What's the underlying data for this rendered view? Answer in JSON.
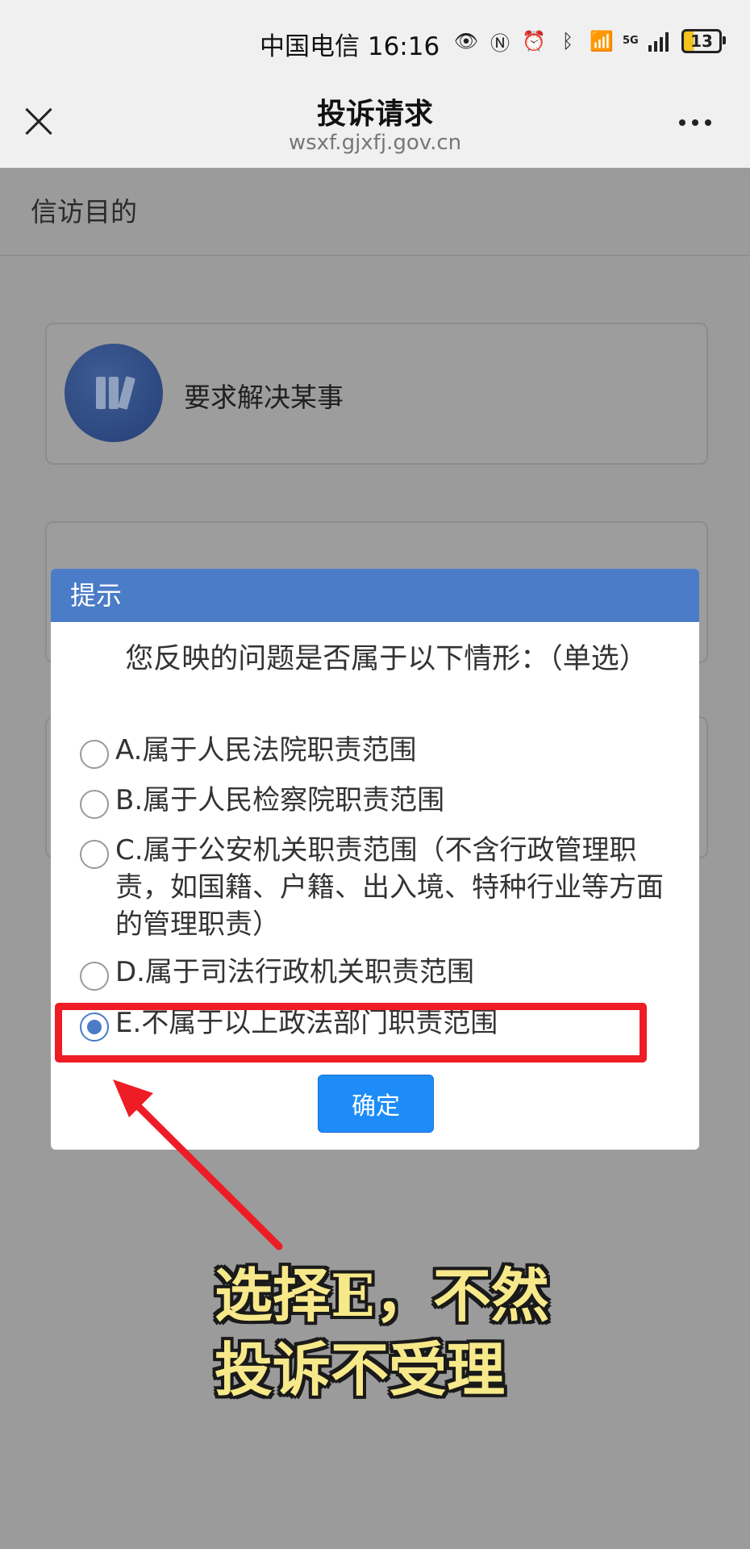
{
  "status_bar": {
    "carrier_time": "中国电信 16:16",
    "network_label": "5G",
    "battery_level": "13"
  },
  "header": {
    "title": "投诉请求",
    "url": "wsxf.gjxfj.gov.cn"
  },
  "page": {
    "section_title": "信访目的",
    "card1_label": "要求解决某事"
  },
  "dialog": {
    "title": "提示",
    "question": "您反映的问题是否属于以下情形：（单选）",
    "options": [
      {
        "label": "A.属于人民法院职责范围",
        "checked": false
      },
      {
        "label": "B.属于人民检察院职责范围",
        "checked": false
      },
      {
        "label": "C.属于公安机关职责范围（不含行政管理职责，如国籍、户籍、出入境、特种行业等方面的管理职责）",
        "checked": false
      },
      {
        "label": "D.属于司法行政机关职责范围",
        "checked": false
      },
      {
        "label": "E.不属于以上政法部门职责范围",
        "checked": true
      }
    ],
    "confirm_label": "确定"
  },
  "annotation": {
    "line1": "选择E，不然",
    "line2": "投诉不受理",
    "highlight_color": "#ee1c25",
    "text_color": "#f7e98a"
  }
}
